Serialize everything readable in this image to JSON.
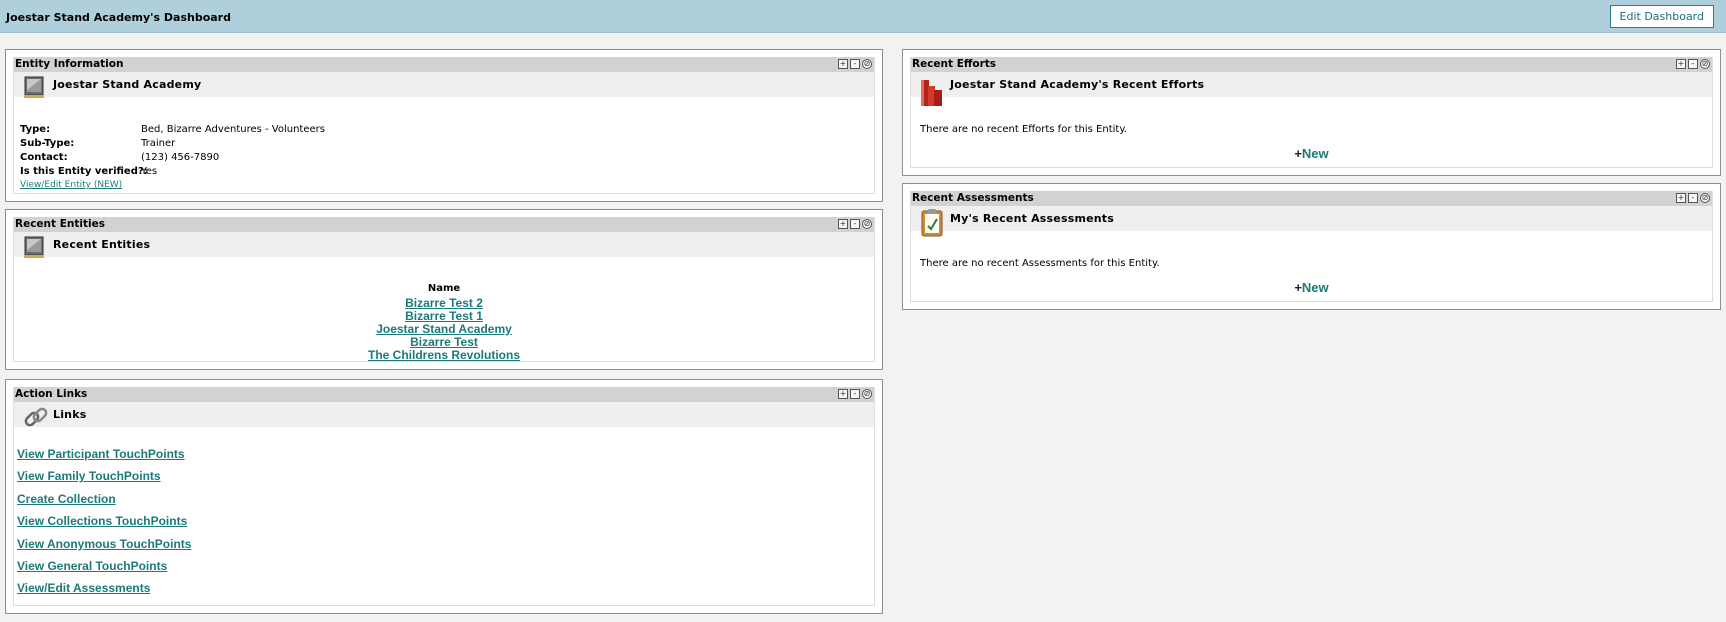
{
  "header": {
    "title": "Joestar Stand Academy's Dashboard",
    "edit_label": "Edit Dashboard"
  },
  "entity_info": {
    "title": "Entity Information",
    "heading": "Joestar Stand Academy",
    "rows": [
      {
        "key": "Type:",
        "value": "Bed, Bizarre Adventures - Volunteers"
      },
      {
        "key": "Sub-Type:",
        "value": "Trainer"
      },
      {
        "key": "Contact:",
        "value": "(123) 456-7890"
      },
      {
        "key": "Is this Entity verified?:",
        "value": "Yes"
      }
    ],
    "link": "View/Edit Entity (NEW)"
  },
  "recent_entities": {
    "title": "Recent Entities",
    "heading": "Recent Entities",
    "column": "Name",
    "items": [
      "Bizarre Test 2",
      "Bizarre Test 1",
      "Joestar Stand Academy",
      "Bizarre Test",
      "The Childrens Revolutions"
    ]
  },
  "action_links": {
    "title": "Action Links",
    "heading": "Links",
    "items": [
      "View Participant TouchPoints",
      "View Family TouchPoints",
      "Create Collection",
      "View Collections TouchPoints",
      "View Anonymous TouchPoints",
      "View General TouchPoints",
      "View/Edit Assessments"
    ]
  },
  "recent_efforts": {
    "title": "Recent Efforts",
    "heading": "Joestar Stand Academy's Recent Efforts",
    "message": "There are no recent Efforts for this Entity.",
    "new_plus": "+",
    "new_label": "New"
  },
  "recent_assessments": {
    "title": "Recent Assessments",
    "heading": "My's Recent Assessments",
    "message": "There are no recent Assessments for this Entity.",
    "new_plus": "+",
    "new_label": "New"
  },
  "widget_controls": {
    "expand": "+",
    "minimize": "-",
    "close": "⊘"
  }
}
